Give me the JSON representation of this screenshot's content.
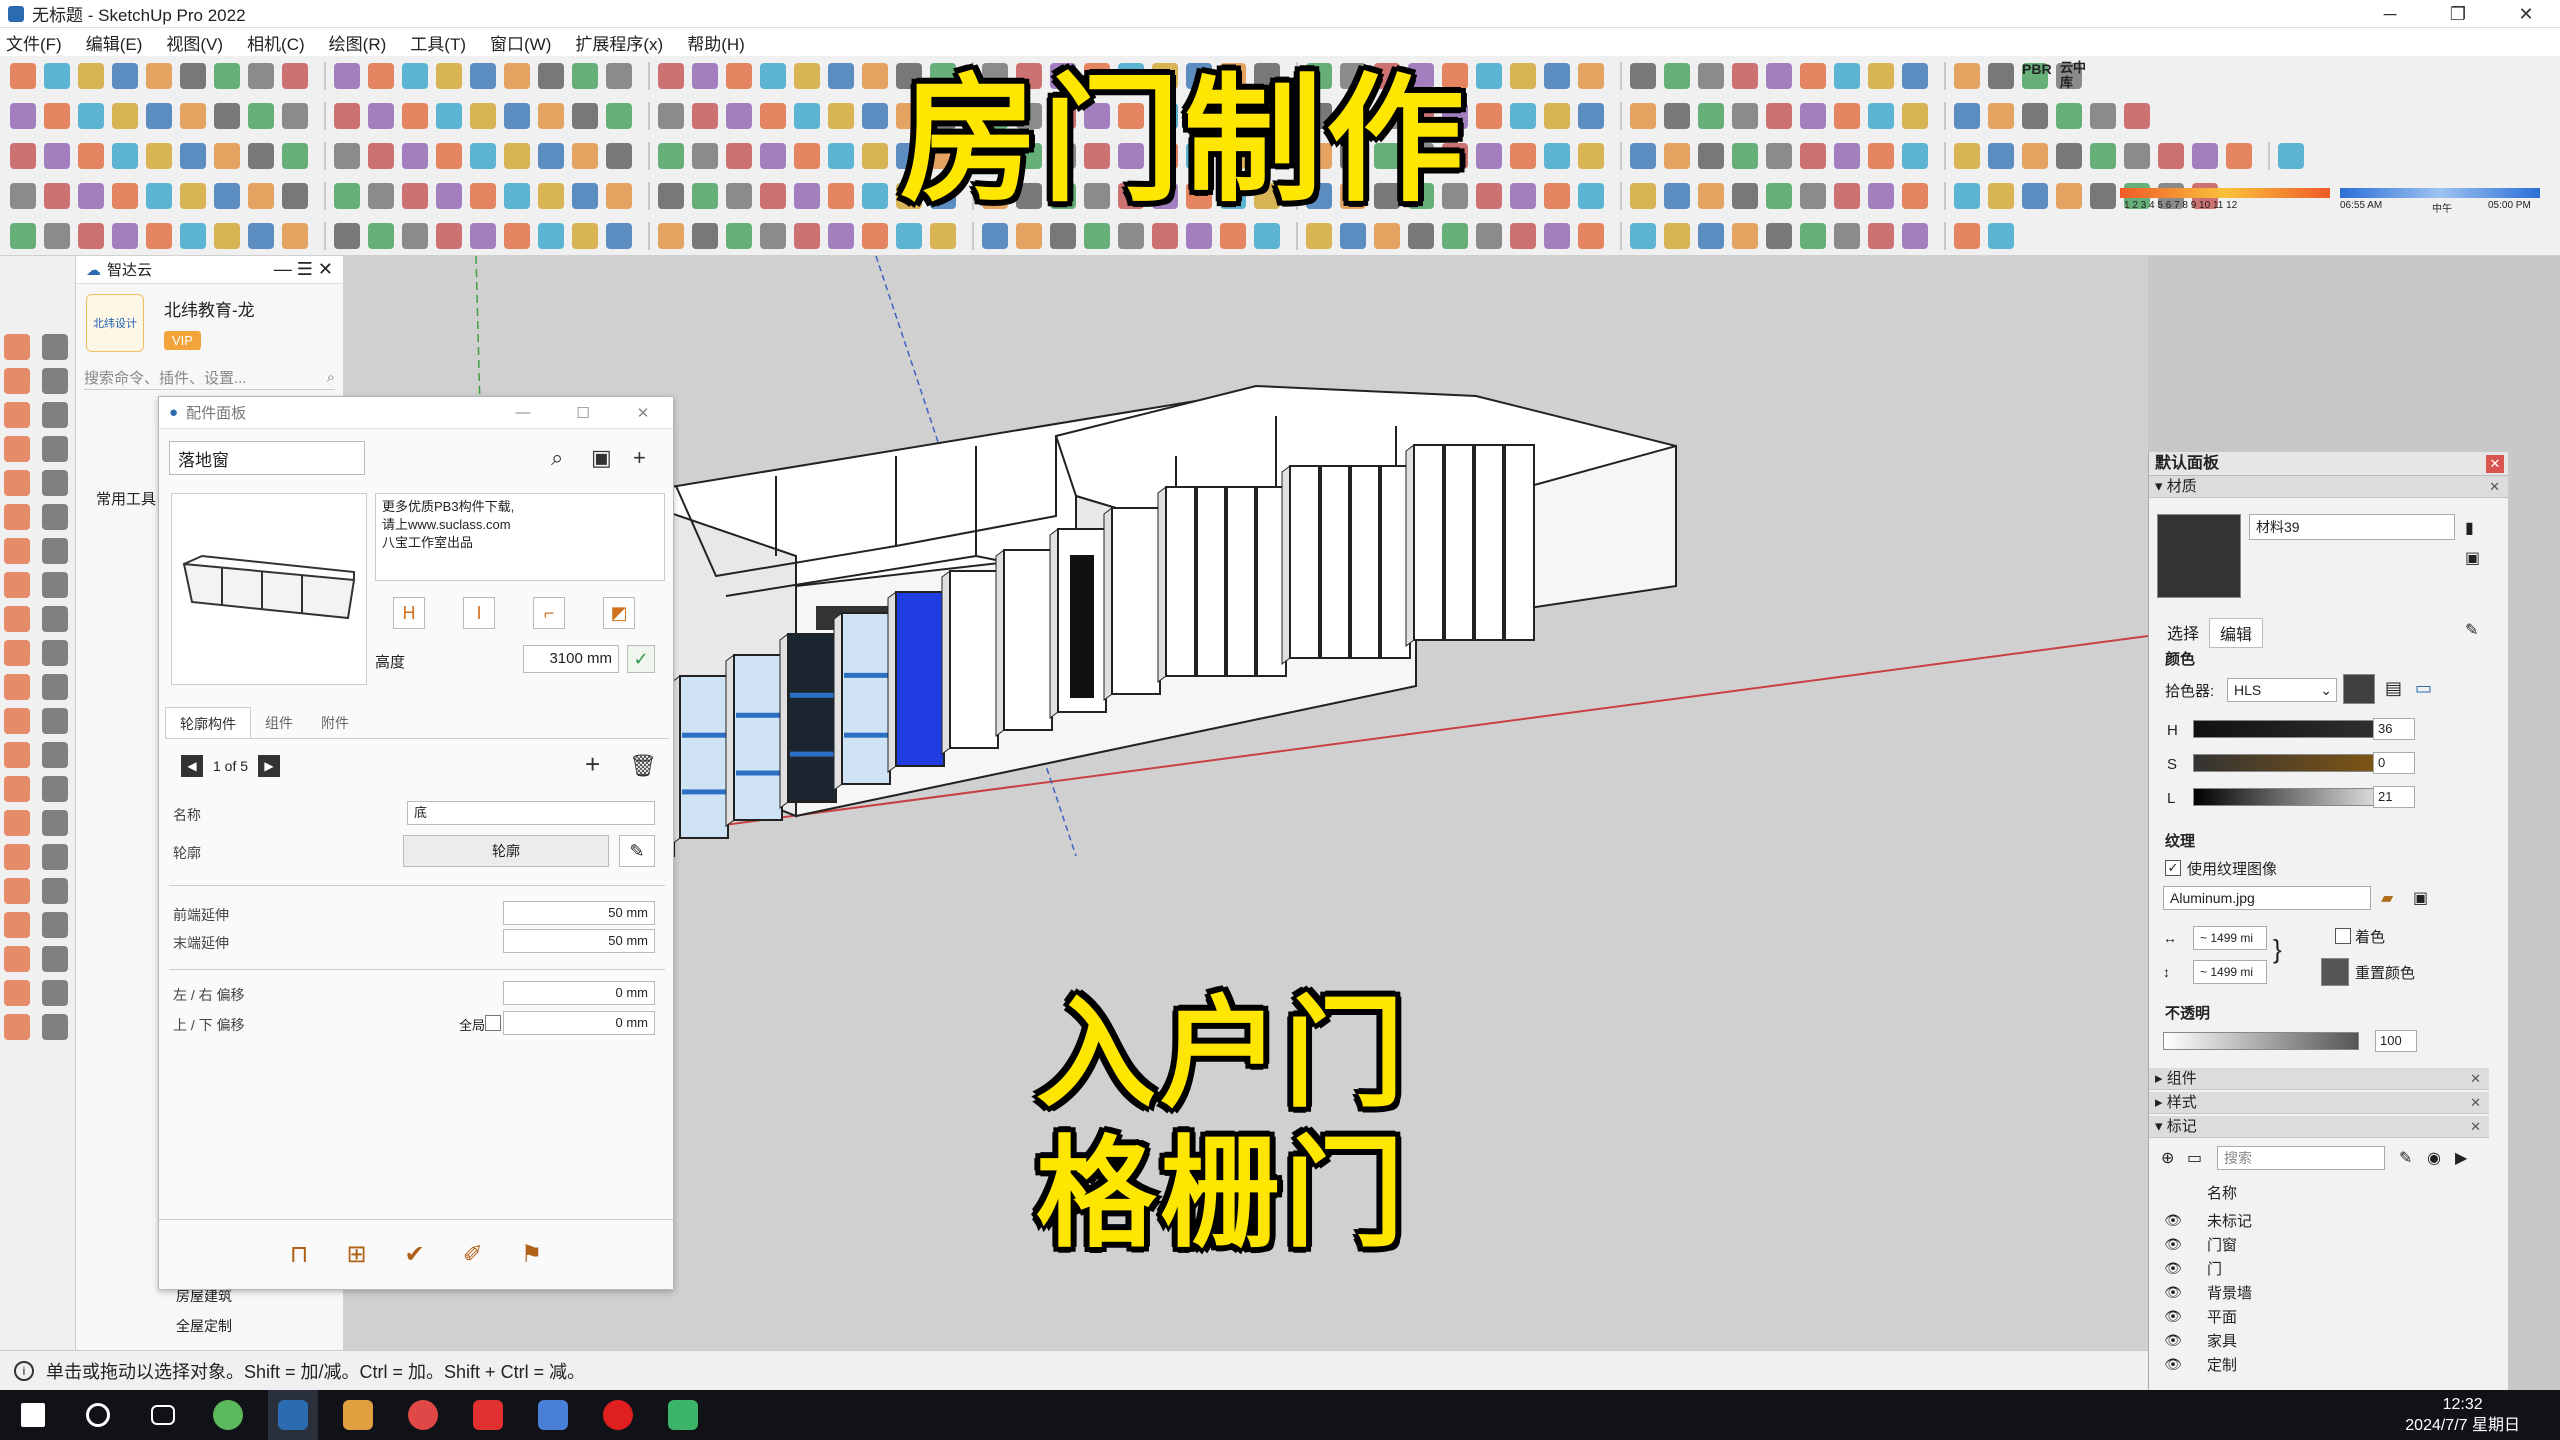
{
  "window": {
    "title": "无标题 - SketchUp Pro 2022",
    "controls": [
      "─",
      "❐",
      "✕"
    ]
  },
  "menu": [
    "文件(F)",
    "编辑(E)",
    "视图(V)",
    "相机(C)",
    "绘图(R)",
    "工具(T)",
    "窗口(W)",
    "扩展程序(x)",
    "帮助(H)"
  ],
  "zhida": {
    "header": "智达云",
    "user": "北纬教育-龙",
    "vip": "VIP",
    "logo_text": "北纬设计",
    "search_placeholder": "搜索命令、插件、设置...",
    "tab": "常用工具",
    "bottom_items": [
      "房屋建筑",
      "全屋定制"
    ]
  },
  "component_panel": {
    "title": "配件面板",
    "search_value": "落地窗",
    "note": "更多优质PB3构件下载,\n请上www.suclass.com\n八宝工作室出品",
    "height_label": "高度",
    "height_value": "3100 mm",
    "tabs": [
      "轮廓构件",
      "组件",
      "附件"
    ],
    "pager": "1 of 5",
    "fields": {
      "name_label": "名称",
      "name_value": "底",
      "profile_label": "轮廓",
      "profile_button": "轮廓",
      "front_extend_label": "前端延伸",
      "front_extend_value": "50 mm",
      "end_extend_label": "末端延伸",
      "end_extend_value": "50 mm",
      "lr_offset_label": "左 / 右 偏移",
      "lr_offset_value": "0 mm",
      "ud_offset_label": "上 / 下 偏移",
      "global_label": "全局",
      "ud_offset_value": "0 mm"
    }
  },
  "default_panel": {
    "title": "默认面板",
    "material_section": "材质",
    "material_name": "材料39",
    "tabs": [
      "选择",
      "编辑"
    ],
    "color_label": "颜色",
    "picker_label": "拾色器:",
    "picker_value": "HLS",
    "h_label": "H",
    "h_value": "36",
    "s_label": "S",
    "s_value": "0",
    "l_label": "L",
    "l_value": "21",
    "texture_label": "纹理",
    "use_texture": "使用纹理图像",
    "texture_file": "Aluminum.jpg",
    "tex_w": "~ 1499 mi",
    "tex_h": "~ 1499 mi",
    "colorize": "着色",
    "reset_color": "重置颜色",
    "opacity_label": "不透明",
    "opacity_value": "100",
    "sections": [
      "组件",
      "样式",
      "标记"
    ],
    "tags_search_placeholder": "搜索",
    "tags_column": "名称",
    "tags": [
      "未标记",
      "门窗",
      "门",
      "背景墙",
      "平面",
      "家具",
      "定制"
    ]
  },
  "status_text": "单击或拖动以选择对象。Shift = 加/减。Ctrl = 加。Shift + Ctrl = 减。",
  "toolbar_labels": {
    "pbr": "PBR",
    "yunzhong": "云中\n库",
    "time1": "06:55 AM",
    "noon": "中午",
    "time2": "05:00 PM",
    "months": "1 2 3 4 5 6 7 8 9 10 11 12"
  },
  "captions": {
    "top": "房门制作",
    "line1": "入户门",
    "line2": "格栅门"
  },
  "clock": {
    "time": "12:32",
    "date": "2024/7/7 星期日"
  },
  "colors": {
    "caption": "#ffe600",
    "selected_door": "#1f3ce0",
    "glass": "#cfe3f4",
    "door_bar": "#2b70c4"
  }
}
